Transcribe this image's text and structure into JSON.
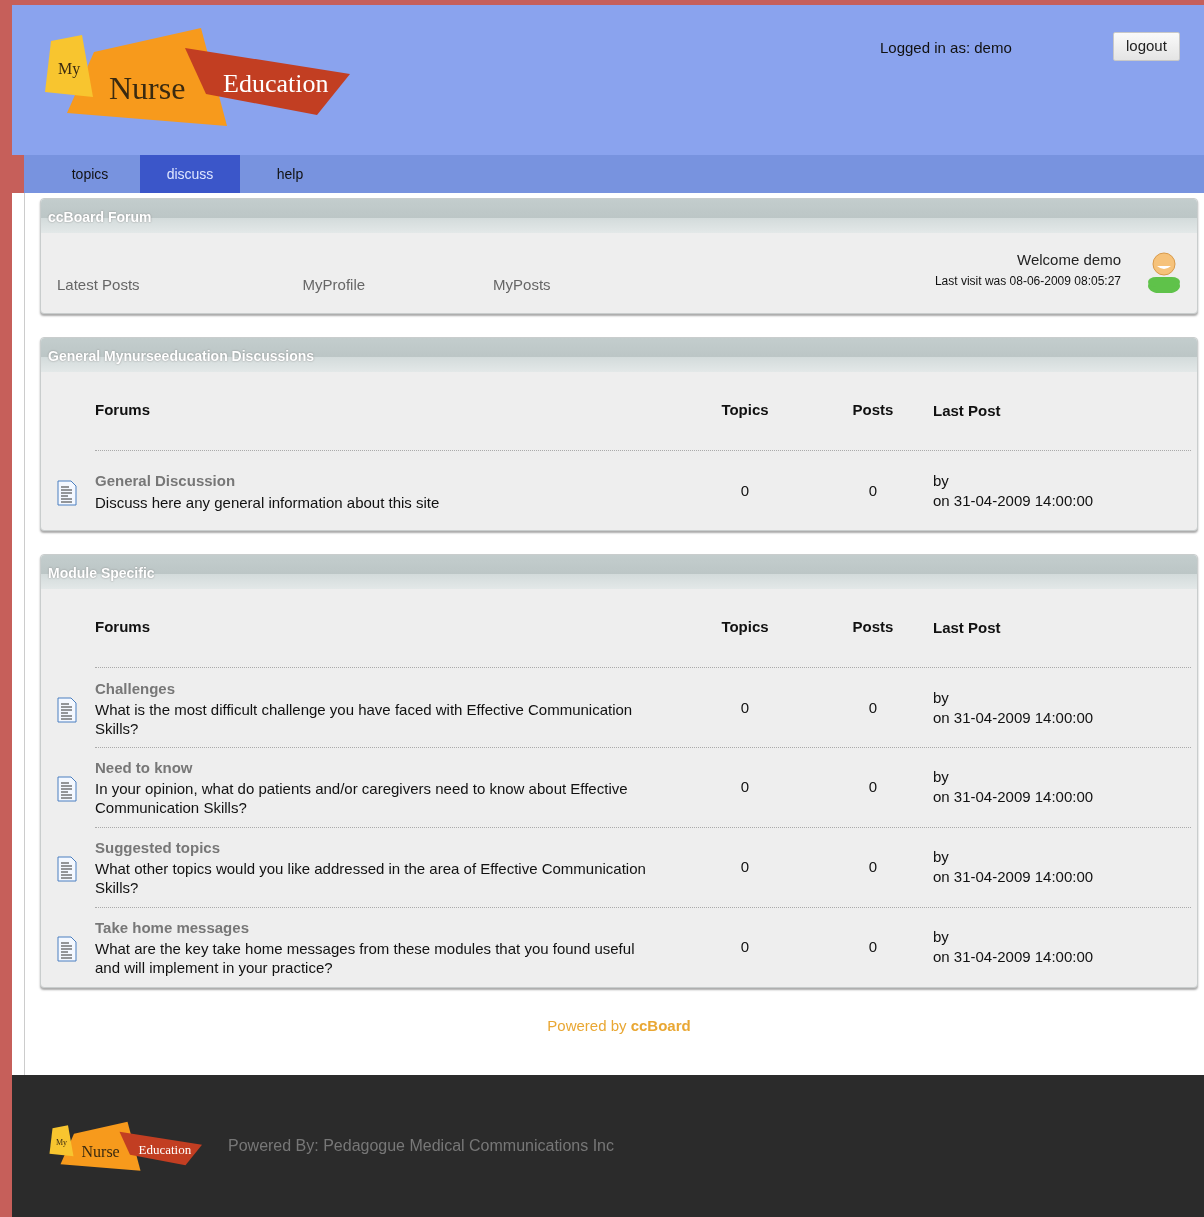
{
  "header": {
    "logo": [
      "My",
      "Nurse",
      "Education"
    ],
    "logged_in": "Logged in as: demo",
    "logout": "logout"
  },
  "nav": [
    {
      "label": "topics",
      "selected": false
    },
    {
      "label": "discuss",
      "selected": true
    },
    {
      "label": "help",
      "selected": false
    }
  ],
  "forum_panel": {
    "title": "ccBoard Forum",
    "links": [
      "Latest Posts",
      "MyProfile",
      "MyPosts"
    ],
    "welcome": "Welcome demo",
    "last_visit": "Last visit was 08-06-2009 08:05:27"
  },
  "sections": [
    {
      "title": "General Mynurseeducation Discussions",
      "columns": [
        "Forums",
        "Topics",
        "Posts",
        "Last Post"
      ],
      "rows": [
        {
          "name": "General Discussion",
          "description": "Discuss here any general information about this site",
          "topics": "0",
          "posts": "0",
          "last_by": "by",
          "last_on": "on 31-04-2009 14:00:00"
        }
      ]
    },
    {
      "title": "Module Specific",
      "columns": [
        "Forums",
        "Topics",
        "Posts",
        "Last Post"
      ],
      "rows": [
        {
          "name": "Challenges",
          "description": "What is the most difficult challenge you have faced with Effective Communication Skills?",
          "topics": "0",
          "posts": "0",
          "last_by": "by",
          "last_on": "on 31-04-2009 14:00:00"
        },
        {
          "name": "Need to know",
          "description": "In your opinion, what do patients and/or caregivers need to know about Effective Communication Skills?",
          "topics": "0",
          "posts": "0",
          "last_by": "by",
          "last_on": "on 31-04-2009 14:00:00"
        },
        {
          "name": "Suggested topics",
          "description": "What other topics would you like addressed in the area of Effective Communication Skills?",
          "topics": "0",
          "posts": "0",
          "last_by": "by",
          "last_on": "on 31-04-2009 14:00:00"
        },
        {
          "name": "Take home messages",
          "description": "What are the key take home messages from these modules that you found useful and will implement in your practice?",
          "topics": "0",
          "posts": "0",
          "last_by": "by",
          "last_on": "on 31-04-2009 14:00:00"
        }
      ]
    }
  ],
  "powered": "Powered by **ccBoard**",
  "footer": {
    "logo": [
      "My",
      "Nurse",
      "Education"
    ],
    "text": "Powered By: Pedagogue Medical Communications Inc"
  }
}
